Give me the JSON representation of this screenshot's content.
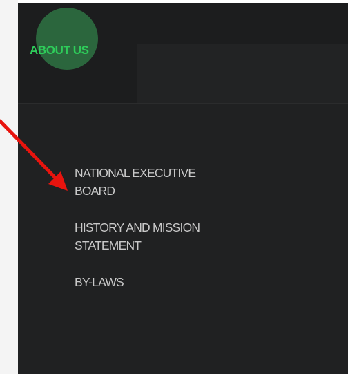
{
  "colors": {
    "panel_bg": "#202122",
    "accent_green": "#2ecc5a",
    "circle_green": "#2c6a3f",
    "menu_text": "#c9c9c9",
    "arrow_red": "#e8140e"
  },
  "nav": {
    "title": "ABOUT US",
    "items": [
      {
        "label": "NATIONAL EXECUTIVE\nBOARD"
      },
      {
        "label": "HISTORY AND MISSION\nSTATEMENT"
      },
      {
        "label": "BY-LAWS"
      }
    ]
  },
  "annotation": {
    "type": "arrow",
    "points_to": "national-executive-board-link",
    "icon": "red-arrow-icon"
  }
}
